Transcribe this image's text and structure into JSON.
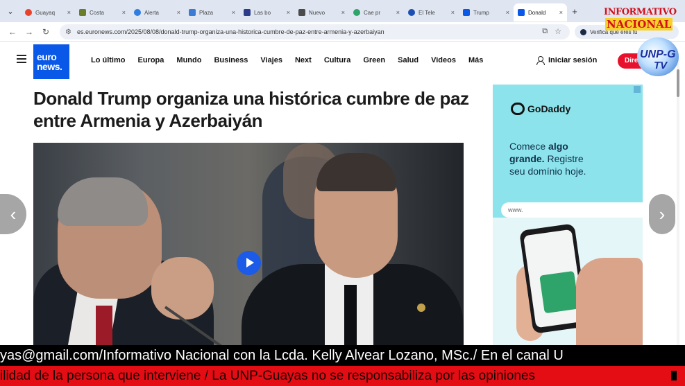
{
  "browser": {
    "tabs": [
      {
        "label": "Guayaq",
        "color": "#e8412c",
        "active": false
      },
      {
        "label": "Costa",
        "color": "#6a7d2a",
        "active": false
      },
      {
        "label": "Alerta",
        "color": "#2f7de1",
        "active": false
      },
      {
        "label": "Plaza",
        "color": "#3a7bd5",
        "active": false
      },
      {
        "label": "Las bo",
        "color": "#2a3c8a",
        "active": false
      },
      {
        "label": "Nuevo",
        "color": "#4a4a4a",
        "active": false
      },
      {
        "label": "Cae pr",
        "color": "#2ea36a",
        "active": false
      },
      {
        "label": "El Tele",
        "color": "#1a4fb4",
        "active": false
      },
      {
        "label": "Trump",
        "color": "#0a58e8",
        "active": false
      },
      {
        "label": "Donald",
        "color": "#0a58e8",
        "active": true
      }
    ],
    "close_glyph": "×",
    "new_tab_glyph": "+",
    "menu_glyph": "⌄",
    "url": "es.euronews.com/2025/08/08/donald-trump-organiza-una-historica-cumbre-de-paz-entre-armenia-y-azerbaiyan",
    "verify_label": "Verifica que eres tú",
    "nav_icons": {
      "back": "←",
      "forward": "→",
      "reload": "↻",
      "site_info": "⚙",
      "screen_share": "⧉",
      "bookmark": "☆"
    }
  },
  "site": {
    "logo_line1": "euro",
    "logo_line2": "news.",
    "brand_color": "#0a58e8",
    "nav": [
      "Lo último",
      "Europa",
      "Mundo",
      "Business",
      "Viajes",
      "Next",
      "Cultura",
      "Green",
      "Salud",
      "Videos",
      "Más"
    ],
    "login_label": "Iniciar sesión",
    "direct_label": "Direct"
  },
  "article": {
    "headline": "Donald Trump organiza una histórica cumbre de paz entre Armenia y Azerbaiyán"
  },
  "ad": {
    "brand": "GoDaddy",
    "line1_a": "Comece ",
    "line1_b": "algo",
    "line2_a": "grande.",
    "line2_b": " Registre",
    "line3": "seu domínio hoje.",
    "search_placeholder": "www."
  },
  "watermark": {
    "line1": "INFORMATIVO",
    "line2": "NACIONAL",
    "line3": "UNP-G",
    "line4": "TV"
  },
  "arrows": {
    "left": "‹",
    "right": "›"
  },
  "ticker": {
    "top": "yas@gmail.com/Informativo Nacional con la Lcda. Kelly Alvear Lozano, MSc./ En el canal U",
    "bottom": "ilidad de la persona que interviene / La UNP-Guayas no se responsabiliza por las opiniones"
  }
}
